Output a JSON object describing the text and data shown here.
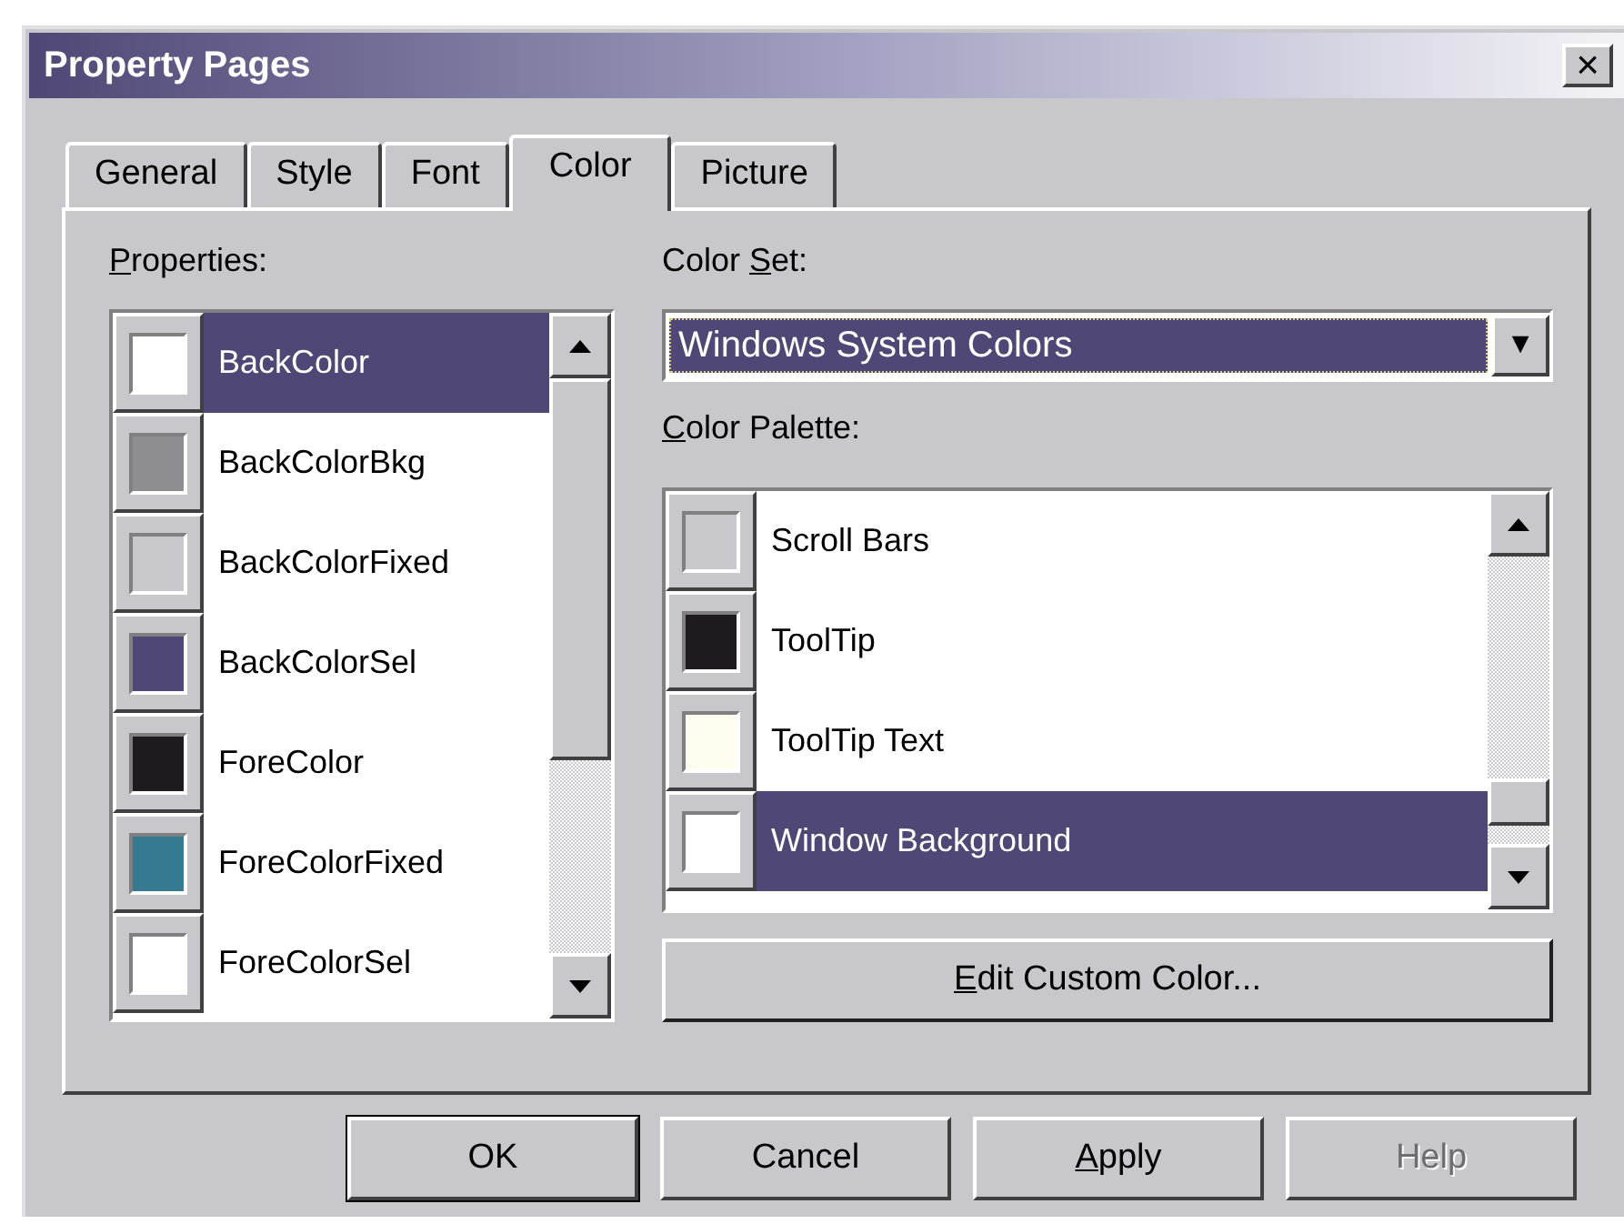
{
  "window": {
    "title": "Property Pages",
    "close": "×"
  },
  "tabs": [
    {
      "label": "General",
      "selected": false
    },
    {
      "label": "Style",
      "selected": false
    },
    {
      "label": "Font",
      "selected": false
    },
    {
      "label": "Color",
      "selected": true
    },
    {
      "label": "Picture",
      "selected": false
    }
  ],
  "properties": {
    "label": {
      "key": "P",
      "after": "roperties:"
    },
    "items": [
      {
        "name": "BackColor",
        "color": "#ffffff",
        "selected": true
      },
      {
        "name": "BackColorBkg",
        "color": "#8e8e92",
        "selected": false
      },
      {
        "name": "BackColorFixed",
        "color": "#c8c8cc",
        "selected": false
      },
      {
        "name": "BackColorSel",
        "color": "#4f4876",
        "selected": false
      },
      {
        "name": "ForeColor",
        "color": "#1e1b1e",
        "selected": false
      },
      {
        "name": "ForeColorFixed",
        "color": "#357a90",
        "selected": false
      },
      {
        "name": "ForeColorSel",
        "color": "#ffffff",
        "selected": false
      }
    ]
  },
  "color_set": {
    "label": {
      "before": "Color ",
      "key": "S",
      "after": "et:"
    },
    "value": "Windows System Colors",
    "arrow": "▼"
  },
  "color_palette": {
    "label": {
      "key": "C",
      "after": "olor Palette:"
    },
    "items": [
      {
        "name": "Scroll Bars",
        "color": "#c8c8cc",
        "selected": false
      },
      {
        "name": "ToolTip",
        "color": "#1e1b1e",
        "selected": false
      },
      {
        "name": "ToolTip Text",
        "color": "#fffdf0",
        "selected": false
      },
      {
        "name": "Window Background",
        "color": "#ffffff",
        "selected": true
      }
    ]
  },
  "edit_button": {
    "label": {
      "key": "E",
      "after": "dit Custom Color..."
    }
  },
  "buttons": [
    {
      "label": {
        "after": "OK"
      },
      "disabled": false
    },
    {
      "label": {
        "after": "Cancel"
      },
      "disabled": false
    },
    {
      "label": {
        "key": "A",
        "after": "pply"
      },
      "disabled": false
    },
    {
      "label": {
        "after": "Help"
      },
      "disabled": true
    }
  ]
}
